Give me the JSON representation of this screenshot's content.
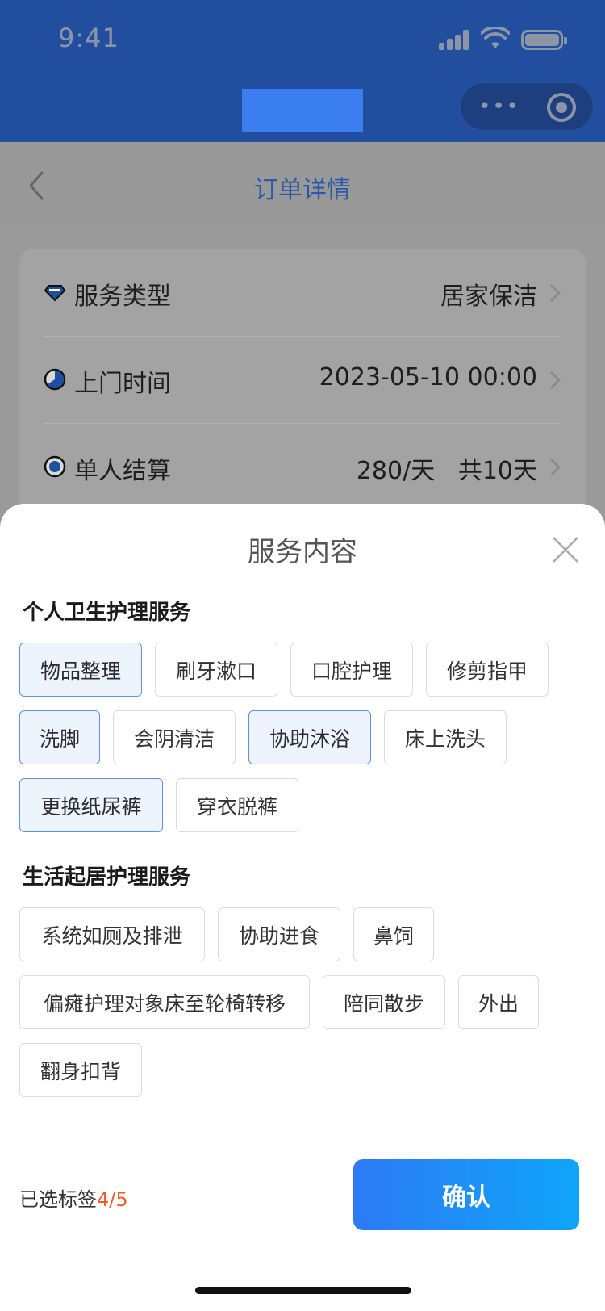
{
  "status_bar": {
    "time": "9:41"
  },
  "nav": {
    "title": "订单详情"
  },
  "order_rows": [
    {
      "label": "服务类型",
      "value": "居家保洁",
      "icon": "diamond-icon"
    },
    {
      "label": "上门时间",
      "value": "2023-05-10 00:00",
      "icon": "clock-icon"
    },
    {
      "label": "单人结算",
      "value": "280/天   共10天",
      "icon": "coin-icon"
    }
  ],
  "sheet": {
    "title": "服务内容",
    "sections": [
      {
        "title": "个人卫生护理服务",
        "tags": [
          {
            "label": "物品整理",
            "selected": true
          },
          {
            "label": "刷牙漱口",
            "selected": false
          },
          {
            "label": "口腔护理",
            "selected": false
          },
          {
            "label": "修剪指甲",
            "selected": false
          },
          {
            "label": "洗脚",
            "selected": true
          },
          {
            "label": "会阴清洁",
            "selected": false
          },
          {
            "label": "协助沐浴",
            "selected": true
          },
          {
            "label": "床上洗头",
            "selected": false
          },
          {
            "label": "更换纸尿裤",
            "selected": true
          },
          {
            "label": "穿衣脱裤",
            "selected": false
          }
        ]
      },
      {
        "title": "生活起居护理服务",
        "tags": [
          {
            "label": "系统如厕及排泄",
            "selected": false
          },
          {
            "label": "协助进食",
            "selected": false
          },
          {
            "label": "鼻饲",
            "selected": false
          },
          {
            "label": "偏瘫护理对象床至轮椅转移",
            "selected": false
          },
          {
            "label": "陪同散步",
            "selected": false
          },
          {
            "label": "外出",
            "selected": false
          },
          {
            "label": "翻身扣背",
            "selected": false
          }
        ]
      }
    ],
    "selected_label": "已选标签",
    "selected_count": "4/5",
    "confirm_label": "确认"
  },
  "colors": {
    "primary": "#2d7af3",
    "accent": "#f05a2a",
    "nav_bg": "#214e9e"
  }
}
